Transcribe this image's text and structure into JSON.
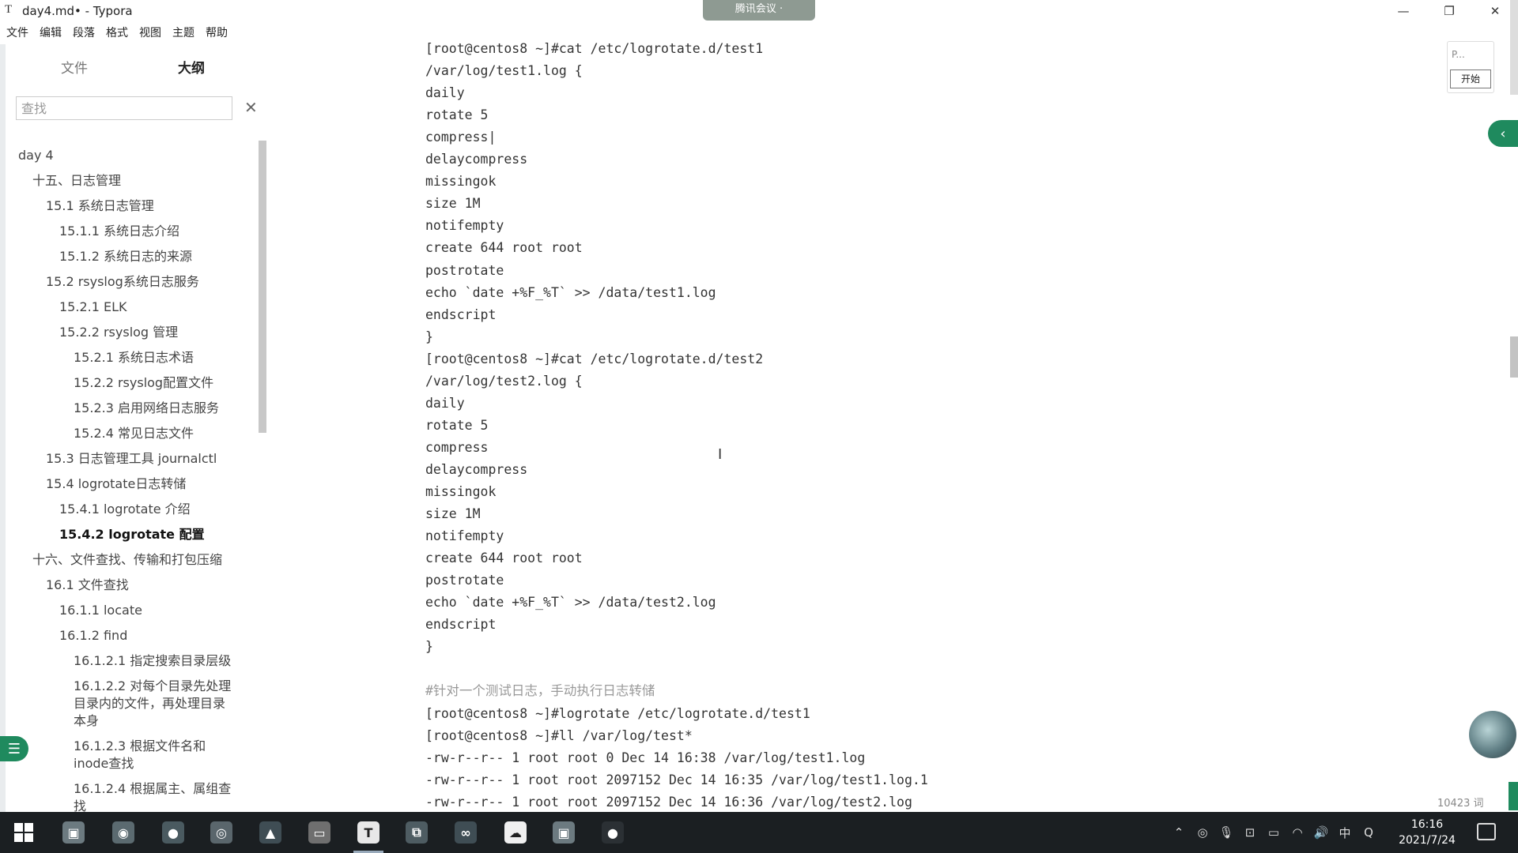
{
  "window": {
    "app_icon": "T",
    "title": "day4.md• - Typora",
    "meeting_label": "腾讯会议 ·",
    "minimize": "—",
    "restore": "❐",
    "close": "✕"
  },
  "menu": [
    "文件",
    "编辑",
    "段落",
    "格式",
    "视图",
    "主题",
    "帮助"
  ],
  "sidebar": {
    "tab_files": "文件",
    "tab_outline": "大纲",
    "search_placeholder": "查找",
    "search_clear": "✕",
    "outline": [
      {
        "text": "day 4",
        "level": 0
      },
      {
        "text": "十五、日志管理",
        "level": 1
      },
      {
        "text": "15.1 系统日志管理",
        "level": 2
      },
      {
        "text": "15.1.1 系统日志介绍",
        "level": 3
      },
      {
        "text": "15.1.2 系统日志的来源",
        "level": 3
      },
      {
        "text": "15.2 rsyslog系统日志服务",
        "level": 2
      },
      {
        "text": "15.2.1 ELK",
        "level": 3
      },
      {
        "text": "15.2.2 rsyslog 管理",
        "level": 3
      },
      {
        "text": "15.2.1 系统日志术语",
        "level": 4
      },
      {
        "text": "15.2.2 rsyslog配置文件",
        "level": 4
      },
      {
        "text": "15.2.3 启用网络日志服务",
        "level": 4
      },
      {
        "text": "15.2.4 常见日志文件",
        "level": 4
      },
      {
        "text": "15.3 日志管理工具 journalctl",
        "level": 2
      },
      {
        "text": "15.4 logrotate日志转储",
        "level": 2
      },
      {
        "text": "15.4.1 logrotate 介绍",
        "level": 3
      },
      {
        "text": "15.4.2 logrotate 配置",
        "level": 3,
        "active": true
      },
      {
        "text": "十六、文件查找、传输和打包压缩",
        "level": 1
      },
      {
        "text": "16.1 文件查找",
        "level": 2
      },
      {
        "text": "16.1.1 locate",
        "level": 3
      },
      {
        "text": "16.1.2 find",
        "level": 3
      },
      {
        "text": "16.1.2.1 指定搜索目录层级",
        "level": 4
      },
      {
        "text": "16.1.2.2 对每个目录先处理\n目录内的文件，再处理目录\n本身",
        "level": 4
      },
      {
        "text": "16.1.2.3 根据文件名和\ninode查找",
        "level": 4
      },
      {
        "text": "16.1.2.4 根据属主、属组查\n找",
        "level": 4
      }
    ],
    "footer_prev": "‹",
    "footer_code": "</>",
    "outline_toggle": "☰"
  },
  "editor": {
    "lines": [
      {
        "text": "[root@centos8 ~]#cat /etc/logrotate.d/test1"
      },
      {
        "text": "/var/log/test1.log {"
      },
      {
        "text": "daily"
      },
      {
        "text": "rotate 5"
      },
      {
        "text": "compress|"
      },
      {
        "text": "delaycompress"
      },
      {
        "text": "missingok"
      },
      {
        "text": "size 1M"
      },
      {
        "text": "notifempty"
      },
      {
        "text": "create 644 root root"
      },
      {
        "text": "postrotate"
      },
      {
        "text": "echo `date +%F_%T` >> /data/test1.log"
      },
      {
        "text": "endscript"
      },
      {
        "text": "}"
      },
      {
        "text": "[root@centos8 ~]#cat /etc/logrotate.d/test2"
      },
      {
        "text": "/var/log/test2.log {"
      },
      {
        "text": "daily"
      },
      {
        "text": "rotate 5"
      },
      {
        "text": "compress"
      },
      {
        "text": "delaycompress"
      },
      {
        "text": "missingok"
      },
      {
        "text": "size 1M"
      },
      {
        "text": "notifempty"
      },
      {
        "text": "create 644 root root"
      },
      {
        "text": "postrotate"
      },
      {
        "text": "echo `date +%F_%T` >> /data/test2.log"
      },
      {
        "text": "endscript"
      },
      {
        "text": "}"
      },
      {
        "text": ""
      },
      {
        "text": "#针对一个测试日志，手动执行日志转储",
        "comment": true
      },
      {
        "text": "[root@centos8 ~]#logrotate /etc/logrotate.d/test1"
      },
      {
        "text": "[root@centos8 ~]#ll /var/log/test*"
      },
      {
        "text": "-rw-r--r-- 1 root root 0 Dec 14 16:38 /var/log/test1.log"
      },
      {
        "text": "-rw-r--r-- 1 root root 2097152 Dec 14 16:35 /var/log/test1.log.1"
      },
      {
        "text": "-rw-r--r-- 1 root root 2097152 Dec 14 16:36 /var/log/test2.log"
      }
    ],
    "text_cursor": "I",
    "word_count": "10423 词"
  },
  "widget": {
    "p_label": "P...",
    "start_label": "开始",
    "collapse": "‹"
  },
  "taskbar": {
    "apps": [
      {
        "name": "screenshot-app",
        "glyph": "▣",
        "color": "#6c7a80"
      },
      {
        "name": "chrome-app",
        "glyph": "◉",
        "color": "#5b6a70"
      },
      {
        "name": "wechat-app",
        "glyph": "●",
        "color": "#4a5a60"
      },
      {
        "name": "netease-app",
        "glyph": "◎",
        "color": "#5a666c"
      },
      {
        "name": "photos-app",
        "glyph": "▲",
        "color": "#3f4d54"
      },
      {
        "name": "explorer-app",
        "glyph": "▭",
        "color": "#6f6f6f"
      },
      {
        "name": "typora-app",
        "glyph": "T",
        "color": "#e8e8e8"
      },
      {
        "name": "vm-app",
        "glyph": "⧉",
        "color": "#4e5c62"
      },
      {
        "name": "fish-app",
        "glyph": "∞",
        "color": "#3f4d54"
      },
      {
        "name": "cloud-app",
        "glyph": "☁",
        "color": "#f0f0f0"
      },
      {
        "name": "screenshot2-app",
        "glyph": "▣",
        "color": "#6c7a80"
      },
      {
        "name": "recorder-app",
        "glyph": "●",
        "color": "#2b3034"
      }
    ],
    "tray": [
      "⌃",
      "◎",
      "🎙",
      "⊡",
      "▭",
      "◠",
      "🔊",
      "中",
      "Q"
    ],
    "time": "16:16",
    "date": "2021/7/24"
  }
}
